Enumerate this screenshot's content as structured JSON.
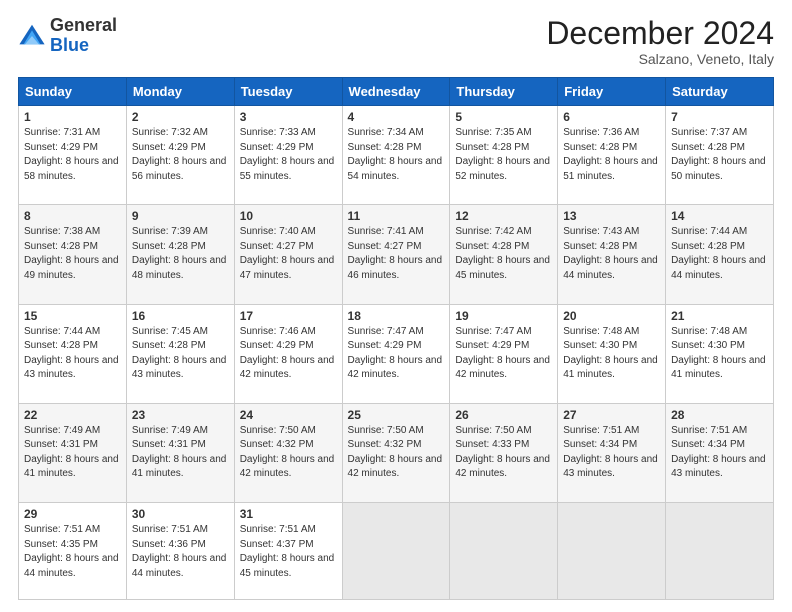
{
  "logo": {
    "general": "General",
    "blue": "Blue"
  },
  "title": "December 2024",
  "subtitle": "Salzano, Veneto, Italy",
  "days_header": [
    "Sunday",
    "Monday",
    "Tuesday",
    "Wednesday",
    "Thursday",
    "Friday",
    "Saturday"
  ],
  "weeks": [
    [
      {
        "day": "1",
        "sunrise": "7:31 AM",
        "sunset": "4:29 PM",
        "daylight": "8 hours and 58 minutes."
      },
      {
        "day": "2",
        "sunrise": "7:32 AM",
        "sunset": "4:29 PM",
        "daylight": "8 hours and 56 minutes."
      },
      {
        "day": "3",
        "sunrise": "7:33 AM",
        "sunset": "4:29 PM",
        "daylight": "8 hours and 55 minutes."
      },
      {
        "day": "4",
        "sunrise": "7:34 AM",
        "sunset": "4:28 PM",
        "daylight": "8 hours and 54 minutes."
      },
      {
        "day": "5",
        "sunrise": "7:35 AM",
        "sunset": "4:28 PM",
        "daylight": "8 hours and 52 minutes."
      },
      {
        "day": "6",
        "sunrise": "7:36 AM",
        "sunset": "4:28 PM",
        "daylight": "8 hours and 51 minutes."
      },
      {
        "day": "7",
        "sunrise": "7:37 AM",
        "sunset": "4:28 PM",
        "daylight": "8 hours and 50 minutes."
      }
    ],
    [
      {
        "day": "8",
        "sunrise": "7:38 AM",
        "sunset": "4:28 PM",
        "daylight": "8 hours and 49 minutes."
      },
      {
        "day": "9",
        "sunrise": "7:39 AM",
        "sunset": "4:28 PM",
        "daylight": "8 hours and 48 minutes."
      },
      {
        "day": "10",
        "sunrise": "7:40 AM",
        "sunset": "4:27 PM",
        "daylight": "8 hours and 47 minutes."
      },
      {
        "day": "11",
        "sunrise": "7:41 AM",
        "sunset": "4:27 PM",
        "daylight": "8 hours and 46 minutes."
      },
      {
        "day": "12",
        "sunrise": "7:42 AM",
        "sunset": "4:28 PM",
        "daylight": "8 hours and 45 minutes."
      },
      {
        "day": "13",
        "sunrise": "7:43 AM",
        "sunset": "4:28 PM",
        "daylight": "8 hours and 44 minutes."
      },
      {
        "day": "14",
        "sunrise": "7:44 AM",
        "sunset": "4:28 PM",
        "daylight": "8 hours and 44 minutes."
      }
    ],
    [
      {
        "day": "15",
        "sunrise": "7:44 AM",
        "sunset": "4:28 PM",
        "daylight": "8 hours and 43 minutes."
      },
      {
        "day": "16",
        "sunrise": "7:45 AM",
        "sunset": "4:28 PM",
        "daylight": "8 hours and 43 minutes."
      },
      {
        "day": "17",
        "sunrise": "7:46 AM",
        "sunset": "4:29 PM",
        "daylight": "8 hours and 42 minutes."
      },
      {
        "day": "18",
        "sunrise": "7:47 AM",
        "sunset": "4:29 PM",
        "daylight": "8 hours and 42 minutes."
      },
      {
        "day": "19",
        "sunrise": "7:47 AM",
        "sunset": "4:29 PM",
        "daylight": "8 hours and 42 minutes."
      },
      {
        "day": "20",
        "sunrise": "7:48 AM",
        "sunset": "4:30 PM",
        "daylight": "8 hours and 41 minutes."
      },
      {
        "day": "21",
        "sunrise": "7:48 AM",
        "sunset": "4:30 PM",
        "daylight": "8 hours and 41 minutes."
      }
    ],
    [
      {
        "day": "22",
        "sunrise": "7:49 AM",
        "sunset": "4:31 PM",
        "daylight": "8 hours and 41 minutes."
      },
      {
        "day": "23",
        "sunrise": "7:49 AM",
        "sunset": "4:31 PM",
        "daylight": "8 hours and 41 minutes."
      },
      {
        "day": "24",
        "sunrise": "7:50 AM",
        "sunset": "4:32 PM",
        "daylight": "8 hours and 42 minutes."
      },
      {
        "day": "25",
        "sunrise": "7:50 AM",
        "sunset": "4:32 PM",
        "daylight": "8 hours and 42 minutes."
      },
      {
        "day": "26",
        "sunrise": "7:50 AM",
        "sunset": "4:33 PM",
        "daylight": "8 hours and 42 minutes."
      },
      {
        "day": "27",
        "sunrise": "7:51 AM",
        "sunset": "4:34 PM",
        "daylight": "8 hours and 43 minutes."
      },
      {
        "day": "28",
        "sunrise": "7:51 AM",
        "sunset": "4:34 PM",
        "daylight": "8 hours and 43 minutes."
      }
    ],
    [
      {
        "day": "29",
        "sunrise": "7:51 AM",
        "sunset": "4:35 PM",
        "daylight": "8 hours and 44 minutes."
      },
      {
        "day": "30",
        "sunrise": "7:51 AM",
        "sunset": "4:36 PM",
        "daylight": "8 hours and 44 minutes."
      },
      {
        "day": "31",
        "sunrise": "7:51 AM",
        "sunset": "4:37 PM",
        "daylight": "8 hours and 45 minutes."
      },
      null,
      null,
      null,
      null
    ]
  ],
  "labels": {
    "sunrise": "Sunrise:",
    "sunset": "Sunset:",
    "daylight": "Daylight:"
  }
}
